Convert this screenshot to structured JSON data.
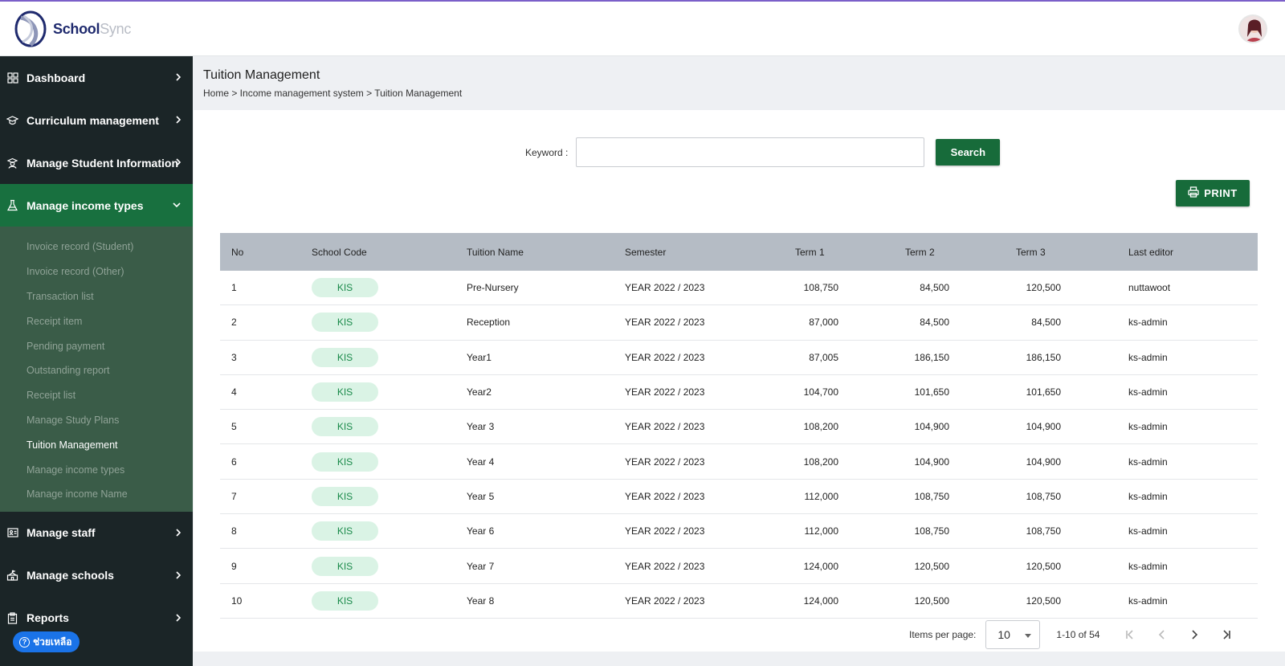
{
  "header": {
    "logo_text_a": "School",
    "logo_text_b": "Sync"
  },
  "sidebar": {
    "items": [
      {
        "label": "Dashboard",
        "icon": "grid-icon"
      },
      {
        "label": "Curriculum management",
        "icon": "graduation-cap-icon"
      },
      {
        "label": "Manage Student Information",
        "icon": "student-icon"
      },
      {
        "label": "Manage income types",
        "icon": "flask-icon"
      },
      {
        "label": "Manage staff",
        "icon": "id-card-icon"
      },
      {
        "label": "Manage schools",
        "icon": "school-icon"
      },
      {
        "label": "Reports",
        "icon": "clipboard-icon"
      }
    ],
    "submenu": [
      "Invoice record (Student)",
      "Invoice record (Other)",
      "Transaction list",
      "Receipt item",
      "Pending payment",
      "Outstanding report",
      "Receipt list",
      "Manage Study Plans",
      "Tuition Management",
      "Manage income types",
      "Manage income Name"
    ],
    "help_label": "ช่วยเหลือ"
  },
  "page": {
    "title": "Tuition Management",
    "breadcrumb": "Home > Income management system > Tuition Management"
  },
  "search": {
    "label": "Keyword :",
    "value": "",
    "button": "Search"
  },
  "print_label": "PRINT",
  "table": {
    "headers": [
      "No",
      "School Code",
      "Tuition Name",
      "Semester",
      "Term 1",
      "Term 2",
      "Term 3",
      "Last editor"
    ],
    "rows": [
      [
        "1",
        "KIS",
        "Pre-Nursery",
        "YEAR 2022 / 2023",
        "108,750",
        "84,500",
        "120,500",
        "nuttawoot"
      ],
      [
        "2",
        "KIS",
        "Reception",
        "YEAR 2022 / 2023",
        "87,000",
        "84,500",
        "84,500",
        "ks-admin"
      ],
      [
        "3",
        "KIS",
        "Year1",
        "YEAR 2022 / 2023",
        "87,005",
        "186,150",
        "186,150",
        "ks-admin"
      ],
      [
        "4",
        "KIS",
        "Year2",
        "YEAR 2022 / 2023",
        "104,700",
        "101,650",
        "101,650",
        "ks-admin"
      ],
      [
        "5",
        "KIS",
        "Year 3",
        "YEAR 2022 / 2023",
        "108,200",
        "104,900",
        "104,900",
        "ks-admin"
      ],
      [
        "6",
        "KIS",
        "Year 4",
        "YEAR 2022 / 2023",
        "108,200",
        "104,900",
        "104,900",
        "ks-admin"
      ],
      [
        "7",
        "KIS",
        "Year 5",
        "YEAR 2022 / 2023",
        "112,000",
        "108,750",
        "108,750",
        "ks-admin"
      ],
      [
        "8",
        "KIS",
        "Year 6",
        "YEAR 2022 / 2023",
        "112,000",
        "108,750",
        "108,750",
        "ks-admin"
      ],
      [
        "9",
        "KIS",
        "Year 7",
        "YEAR 2022 / 2023",
        "124,000",
        "120,500",
        "120,500",
        "ks-admin"
      ],
      [
        "10",
        "KIS",
        "Year 8",
        "YEAR 2022 / 2023",
        "124,000",
        "120,500",
        "120,500",
        "ks-admin"
      ]
    ]
  },
  "pagination": {
    "items_per_page_label": "Items per page:",
    "items_per_page": "10",
    "range": "1-10 of 54"
  },
  "colors": {
    "accent": "#176b3a",
    "sidebar_bg": "#1b2527",
    "badge_bg": "#daf3e5"
  }
}
